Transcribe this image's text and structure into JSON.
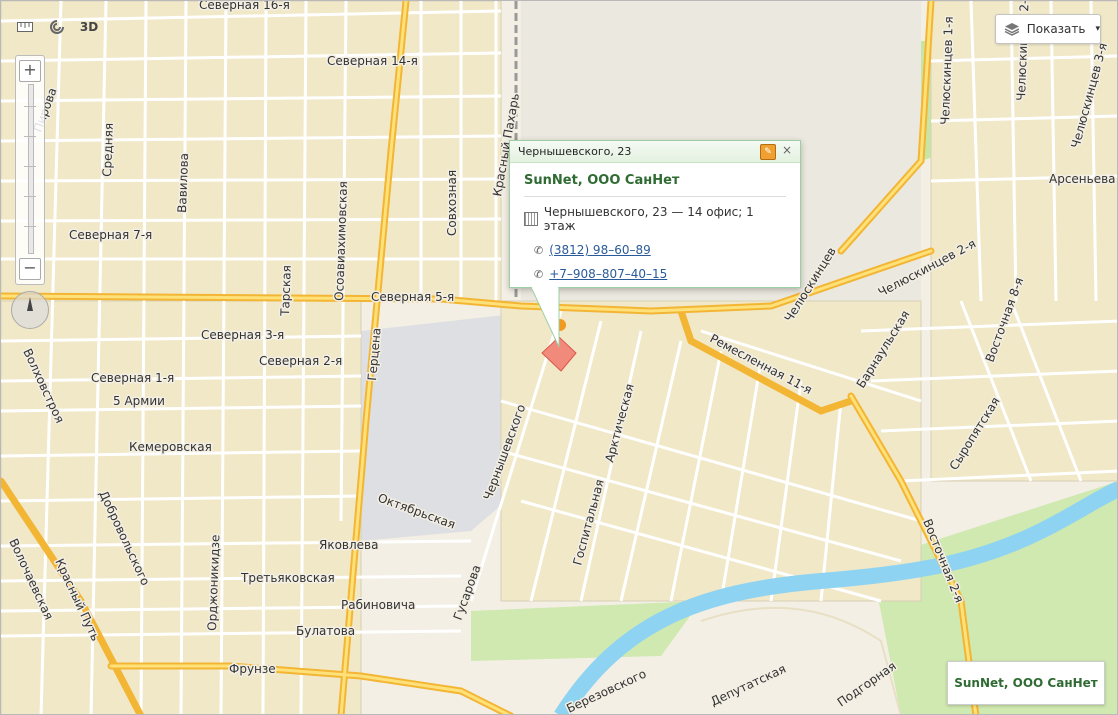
{
  "toolbar": {
    "ruler_icon": "ruler-icon",
    "traffic_icon": "traffic-icon",
    "view_3d_label": "3D"
  },
  "zoom": {
    "plus_label": "+",
    "minus_label": "−"
  },
  "layers_button": {
    "label": "Показать",
    "icon": "layers-icon"
  },
  "balloon": {
    "header": "Чернышевского, 23",
    "company": "SunNet, ООО СанНет",
    "address": "Чернышевского, 23 — 14 офис; 1 этаж",
    "phones": [
      "(3812) 98–60–89",
      "+7–908–807–40–15"
    ]
  },
  "placard": {
    "label": "SunNet, ООО СанНет"
  },
  "streets": [
    "Северная 16-я",
    "Северная 14-я",
    "Северная 7-я",
    "Северная 5-я",
    "Северная 3-я",
    "Северная 2-я",
    "Северная 1-я",
    "5 Армии",
    "Кемеровская",
    "Октябрьская",
    "Яковлева",
    "Третьяковская",
    "Рабиновича",
    "Булатова",
    "Фрунзе",
    "Волочаевская",
    "Красный Путь",
    "Добровольского",
    "Орджоникидзе",
    "Герцена",
    "Гусарова",
    "Чернышевского",
    "Госпитальная",
    "Арктическая",
    "Ремесленная 11-я",
    "Челюскинцев",
    "Барнаульская",
    "Сыропятская",
    "Восточная 2-я",
    "Восточная 8-я",
    "Челюскинцев 2-я",
    "Арсеньева",
    "Челюскинцев 1-я",
    "Челюскинцев 2-я",
    "Челюскинцев 3-я",
    "Красный Пахарь",
    "Совхозная",
    "Осоавиахимовская",
    "Тарская",
    "Вавилова",
    "Средняя",
    "Волховстроя",
    "Березовского",
    "Депутатская",
    "Подгорная",
    "Пирова"
  ]
}
